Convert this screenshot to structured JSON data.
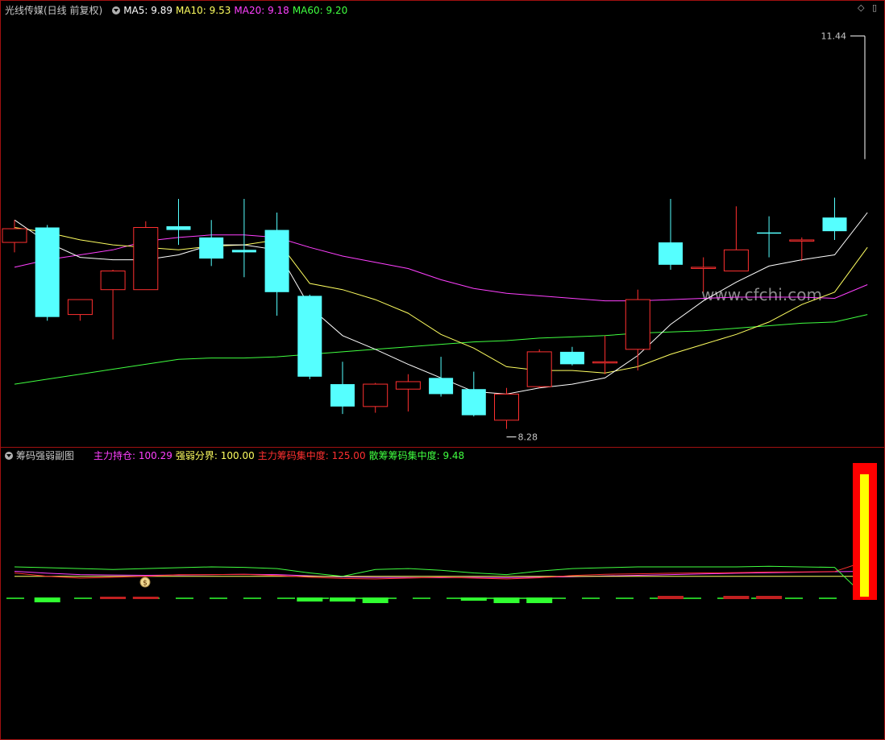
{
  "main_legend": {
    "stock": "光线传媒(日线 前复权)",
    "items": [
      {
        "label": "MA5: 9.89",
        "color": "#ffffff"
      },
      {
        "label": "MA10: 9.53",
        "color": "#ffff60"
      },
      {
        "label": "MA20: 9.18",
        "color": "#ff40ff"
      },
      {
        "label": "MA60: 9.20",
        "color": "#40ff40"
      }
    ]
  },
  "sub_legend": {
    "name": "筹码强弱副图",
    "items": [
      {
        "label": "主力持仓: 100.29",
        "color": "#ff40ff"
      },
      {
        "label": "强弱分界: 100.00",
        "color": "#ffff60"
      },
      {
        "label": "主力筹码集中度: 125.00",
        "color": "#ff3030"
      },
      {
        "label": "散筹筹码集中度: 9.48",
        "color": "#40ff40"
      }
    ]
  },
  "watermark": "www.cfchi.com",
  "corner_icons": {
    "diamond": "◇",
    "window": "▯"
  },
  "colors": {
    "up": "#ff3030",
    "down": "#55ffff",
    "ma5": "#ffffff",
    "ma10": "#ffff60",
    "ma20": "#ff40ff",
    "ma60": "#40ff40"
  },
  "chart_data": [
    {
      "type": "candlestick",
      "annotations": {
        "high_label": "11.44",
        "low_label": "8.28"
      },
      "candles": [
        {
          "o": 9.78,
          "h": 9.96,
          "c": 9.89,
          "l": 9.7,
          "dir": "up"
        },
        {
          "o": 9.9,
          "h": 9.92,
          "c": 9.18,
          "l": 9.15,
          "dir": "down"
        },
        {
          "o": 9.2,
          "h": 9.3,
          "c": 9.32,
          "l": 9.15,
          "dir": "up"
        },
        {
          "o": 9.4,
          "h": 9.56,
          "c": 9.55,
          "l": 9.0,
          "dir": "up"
        },
        {
          "o": 9.4,
          "h": 9.95,
          "c": 9.9,
          "l": 9.4,
          "dir": "up"
        },
        {
          "o": 9.91,
          "h": 10.13,
          "c": 9.88,
          "l": 9.76,
          "dir": "down"
        },
        {
          "o": 9.82,
          "h": 9.96,
          "c": 9.65,
          "l": 9.59,
          "dir": "down"
        },
        {
          "o": 9.72,
          "h": 10.13,
          "c": 9.7,
          "l": 9.5,
          "dir": "down"
        },
        {
          "o": 9.88,
          "h": 10.02,
          "c": 9.38,
          "l": 9.19,
          "dir": "down"
        },
        {
          "o": 9.35,
          "h": 9.36,
          "c": 8.7,
          "l": 8.68,
          "dir": "down"
        },
        {
          "o": 8.64,
          "h": 8.82,
          "c": 8.46,
          "l": 8.4,
          "dir": "down"
        },
        {
          "o": 8.46,
          "h": 8.65,
          "c": 8.64,
          "l": 8.41,
          "dir": "up"
        },
        {
          "o": 8.6,
          "h": 8.72,
          "c": 8.66,
          "l": 8.42,
          "dir": "up"
        },
        {
          "o": 8.69,
          "h": 8.86,
          "c": 8.56,
          "l": 8.54,
          "dir": "down"
        },
        {
          "o": 8.6,
          "h": 8.74,
          "c": 8.39,
          "l": 8.38,
          "dir": "down"
        },
        {
          "o": 8.35,
          "h": 8.61,
          "c": 8.56,
          "l": 8.28,
          "dir": "up"
        },
        {
          "o": 8.62,
          "h": 8.92,
          "c": 8.9,
          "l": 8.61,
          "dir": "up"
        },
        {
          "o": 8.9,
          "h": 8.94,
          "c": 8.8,
          "l": 8.79,
          "dir": "down"
        },
        {
          "o": 8.82,
          "h": 9.03,
          "c": 8.82,
          "l": 8.72,
          "dir": "up"
        },
        {
          "o": 8.92,
          "h": 9.4,
          "c": 9.32,
          "l": 8.75,
          "dir": "up"
        },
        {
          "o": 9.78,
          "h": 10.13,
          "c": 9.6,
          "l": 9.56,
          "dir": "down"
        },
        {
          "o": 9.58,
          "h": 9.66,
          "c": 9.58,
          "l": 9.38,
          "dir": "up"
        },
        {
          "o": 9.55,
          "h": 10.07,
          "c": 9.72,
          "l": 9.55,
          "dir": "up"
        },
        {
          "o": 9.86,
          "h": 9.99,
          "c": 9.86,
          "l": 9.66,
          "dir": "down"
        },
        {
          "o": 9.8,
          "h": 9.82,
          "c": 9.8,
          "l": 9.63,
          "dir": "up"
        },
        {
          "o": 9.98,
          "h": 10.14,
          "c": 9.87,
          "l": 9.8,
          "dir": "down"
        }
      ],
      "ma5": [
        9.96,
        9.78,
        9.66,
        9.64,
        9.64,
        9.68,
        9.76,
        9.76,
        9.72,
        9.26,
        9.03,
        8.92,
        8.8,
        8.69,
        8.58,
        8.56,
        8.61,
        8.64,
        8.69,
        8.87,
        9.12,
        9.31,
        9.46,
        9.59,
        9.64,
        9.68,
        10.02
      ],
      "ma10": [
        9.9,
        9.86,
        9.8,
        9.76,
        9.74,
        9.72,
        9.75,
        9.76,
        9.8,
        9.45,
        9.4,
        9.32,
        9.21,
        9.04,
        8.93,
        8.78,
        8.75,
        8.75,
        8.73,
        8.78,
        8.88,
        8.96,
        9.04,
        9.14,
        9.28,
        9.38,
        9.74
      ],
      "ma20": [
        9.58,
        9.64,
        9.68,
        9.72,
        9.79,
        9.82,
        9.84,
        9.84,
        9.82,
        9.74,
        9.67,
        9.62,
        9.57,
        9.48,
        9.41,
        9.37,
        9.35,
        9.33,
        9.31,
        9.31,
        9.32,
        9.33,
        9.34,
        9.34,
        9.34,
        9.33,
        9.44
      ],
      "ma60": [
        8.64,
        8.68,
        8.72,
        8.76,
        8.8,
        8.84,
        8.85,
        8.85,
        8.86,
        8.88,
        8.9,
        8.92,
        8.94,
        8.96,
        8.98,
        8.99,
        9.01,
        9.02,
        9.03,
        9.05,
        9.06,
        9.07,
        9.09,
        9.11,
        9.13,
        9.14,
        9.2
      ]
    },
    {
      "type": "line",
      "series": [
        {
          "name": "主力持仓",
          "values": [
            100.29,
            100.18,
            100.1,
            100.08,
            100.06,
            100.08,
            100.1,
            100.12,
            100.1,
            100.03,
            99.96,
            99.94,
            99.93,
            99.92,
            99.94,
            99.92,
            99.95,
            99.98,
            100.02,
            100.06,
            100.1,
            100.14,
            100.18,
            100.21,
            100.24,
            100.27,
            100.29
          ]
        },
        {
          "name": "强弱分界",
          "values": [
            100,
            100,
            100,
            100,
            100,
            100,
            100,
            100,
            100,
            100,
            100,
            100,
            100,
            100,
            100,
            100,
            100,
            100,
            100,
            100,
            100,
            100,
            100,
            100,
            100,
            100,
            100
          ]
        },
        {
          "name": "主力筹码集中度",
          "values": [
            100.2,
            100.0,
            99.9,
            99.95,
            100.0,
            100.1,
            100.1,
            100.12,
            100.05,
            99.95,
            99.88,
            99.85,
            99.9,
            99.95,
            99.9,
            99.85,
            99.92,
            100.05,
            100.12,
            100.15,
            100.18,
            100.2,
            100.22,
            100.25,
            100.26,
            100.28,
            100.9
          ]
        },
        {
          "name": "散筹筹码集中度",
          "values": [
            100.55,
            100.5,
            100.45,
            100.4,
            100.45,
            100.5,
            100.55,
            100.52,
            100.45,
            100.2,
            100.0,
            100.4,
            100.45,
            100.35,
            100.2,
            100.1,
            100.3,
            100.45,
            100.5,
            100.55,
            100.55,
            100.55,
            100.55,
            100.58,
            100.55,
            100.52,
            98.7
          ]
        }
      ],
      "bars": [
        {
          "idx": 1,
          "v": -0.4,
          "c": "#30ff30"
        },
        {
          "idx": 3,
          "v": 0.1,
          "c": "#c02020"
        },
        {
          "idx": 4,
          "v": 0.1,
          "c": "#c02020"
        },
        {
          "idx": 9,
          "v": -0.3,
          "c": "#30ff30"
        },
        {
          "idx": 10,
          "v": -0.3,
          "c": "#30ff30"
        },
        {
          "idx": 11,
          "v": -0.5,
          "c": "#30ff30"
        },
        {
          "idx": 14,
          "v": -0.2,
          "c": "#30ff30"
        },
        {
          "idx": 15,
          "v": -0.5,
          "c": "#30ff30"
        },
        {
          "idx": 16,
          "v": -0.5,
          "c": "#30ff30"
        },
        {
          "idx": 20,
          "v": 0.2,
          "c": "#c02020"
        },
        {
          "idx": 22,
          "v": 0.2,
          "c": "#c02020"
        },
        {
          "idx": 23,
          "v": 0.2,
          "c": "#c02020"
        }
      ]
    }
  ]
}
